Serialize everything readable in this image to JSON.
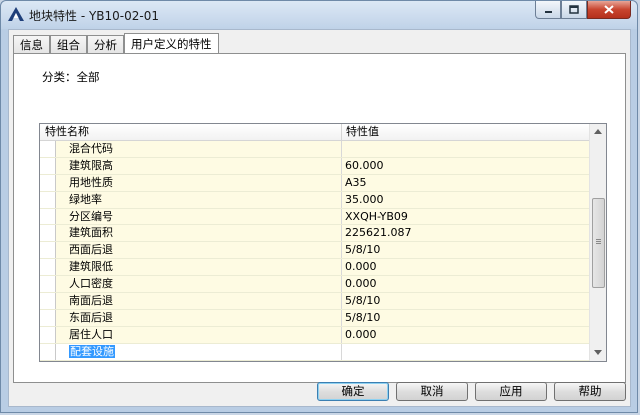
{
  "window": {
    "title": "地块特性 - YB10-02-01"
  },
  "tabs": [
    {
      "label": "信息"
    },
    {
      "label": "组合"
    },
    {
      "label": "分析"
    },
    {
      "label": "用户定义的特性"
    }
  ],
  "category": {
    "label": "分类：全部"
  },
  "grid": {
    "columns": {
      "name": "特性名称",
      "value": "特性值"
    },
    "rows": [
      {
        "name": "混合代码",
        "value": ""
      },
      {
        "name": "建筑限高",
        "value": "60.000"
      },
      {
        "name": "用地性质",
        "value": "A35"
      },
      {
        "name": "绿地率",
        "value": "35.000"
      },
      {
        "name": "分区编号",
        "value": "XXQH-YB09"
      },
      {
        "name": "建筑面积",
        "value": "225621.087"
      },
      {
        "name": "西面后退",
        "value": "5/8/10"
      },
      {
        "name": "建筑限低",
        "value": "0.000"
      },
      {
        "name": "人口密度",
        "value": "0.000"
      },
      {
        "name": "南面后退",
        "value": "5/8/10"
      },
      {
        "name": "东面后退",
        "value": "5/8/10"
      },
      {
        "name": "居住人口",
        "value": "0.000"
      },
      {
        "name": "配套设施",
        "value": ""
      }
    ],
    "selected_row": "配套设施"
  },
  "buttons": {
    "ok": "确定",
    "cancel": "取消",
    "apply": "应用",
    "help": "帮助"
  },
  "colors": {
    "row_bg": "#fefbe3",
    "selection": "#3399ff",
    "close": "#c8452f"
  }
}
